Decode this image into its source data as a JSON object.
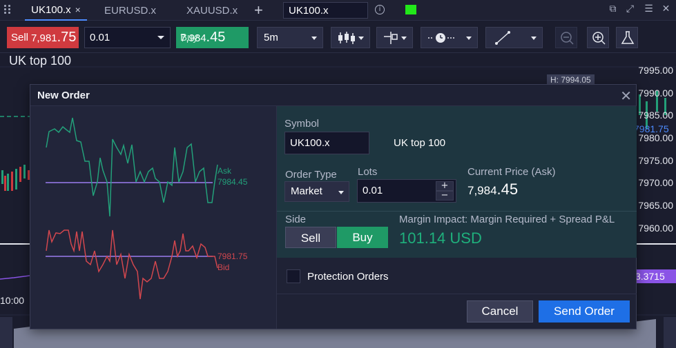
{
  "tabs": [
    {
      "label": "UK100.x",
      "active": true,
      "close": "×"
    },
    {
      "label": "EURUSD.x",
      "active": false,
      "close": ""
    },
    {
      "label": "XAUUSD.x",
      "active": false,
      "close": ""
    }
  ],
  "symbol_search_value": "UK100.x",
  "toolbar": {
    "sell_label": "Sell",
    "sell_price_small": "7,981",
    "sell_price_big": ".75",
    "lot_size": "0.01",
    "buy_price_small": "7,984",
    "buy_price_big": ".45",
    "buy_label": "Buy",
    "timeframe": "5m"
  },
  "chart": {
    "title": "UK top 100",
    "price_labels": [
      "7995.00",
      "7990.00",
      "7985.00",
      "7980.00",
      "7975.00",
      "7970.00",
      "7965.00",
      "7960.00"
    ],
    "high_badge": "H: 7994.05",
    "current_price": "7981.75",
    "indicator_value": "3.3715",
    "time_label": "10:00"
  },
  "modal": {
    "title": "New Order",
    "ask_label": "Ask",
    "ask_value": "7984.45",
    "bid_value": "7981.75",
    "bid_label": "Bid",
    "symbol_label": "Symbol",
    "symbol_value": "UK100.x",
    "symbol_name": "UK top 100",
    "order_type_label": "Order Type",
    "order_type_value": "Market",
    "lots_label": "Lots",
    "lots_value": "0.01",
    "current_price_label": "Current Price (Ask)",
    "current_price_small": "7,984",
    "current_price_big": ".45",
    "side_label": "Side",
    "side_sell": "Sell",
    "side_buy": "Buy",
    "margin_label": "Margin Impact: Margin Required + Spread P&L",
    "margin_value": "101.14 USD",
    "protection_label": "Protection Orders",
    "cancel_label": "Cancel",
    "send_label": "Send Order"
  },
  "colors": {
    "buy": "#1f9a66",
    "sell": "#cf3a3f",
    "ask_line": "#23a07a",
    "bid_line": "#d2474e",
    "accent": "#1e6fe6",
    "indicator": "#8a54e6"
  }
}
